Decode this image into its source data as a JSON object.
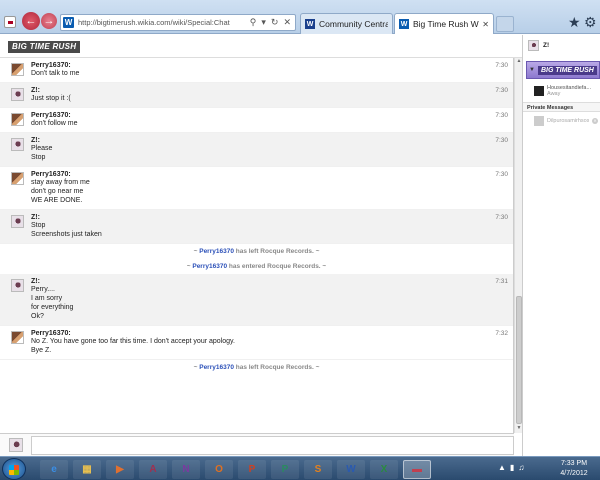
{
  "browser": {
    "address": "http://bigtimerush.wikia.com/wiki/Special:Chat",
    "tabs": [
      {
        "label": "Community Central: W...",
        "icon": "W"
      },
      {
        "label": "Big Time Rush Wiki: ...",
        "icon": "W"
      }
    ],
    "address_icon": "W"
  },
  "wiki": {
    "brand": "BIG TIME RUSH"
  },
  "messages": [
    {
      "user": "Perry16370:",
      "lines": [
        "Don't talk to me"
      ],
      "time": "7:30",
      "alt": false,
      "avatar": "perry"
    },
    {
      "user": "Z!:",
      "lines": [
        "Just stop it :("
      ],
      "time": "7:30",
      "alt": true,
      "avatar": "z"
    },
    {
      "user": "Perry16370:",
      "lines": [
        "don't follow me"
      ],
      "time": "7:30",
      "alt": false,
      "avatar": "perry"
    },
    {
      "user": "Z!:",
      "lines": [
        "Please",
        "Stop"
      ],
      "time": "7:30",
      "alt": true,
      "avatar": "z"
    },
    {
      "user": "Perry16370:",
      "lines": [
        "stay away from me",
        "don't go near me",
        "WE ARE DONE."
      ],
      "time": "7:30",
      "alt": false,
      "avatar": "perry"
    },
    {
      "user": "Z!:",
      "lines": [
        "Stop",
        "Screenshots just taken"
      ],
      "time": "7:30",
      "alt": true,
      "avatar": "z"
    }
  ],
  "notices": [
    {
      "prefix": "~ ",
      "name": "Perry16370",
      "text": " has left Rocque Records. ~"
    },
    {
      "prefix": "~ ",
      "name": "Perry16370",
      "text": " has entered Rocque Records. ~"
    }
  ],
  "messages2": [
    {
      "user": "Z!:",
      "lines": [
        "Perry....",
        "I am sorry",
        "for everything",
        "Ok?"
      ],
      "time": "7:31",
      "alt": true,
      "avatar": "z"
    },
    {
      "user": "Perry16370:",
      "lines": [
        "No Z. You have gone too far this time. I don't accept your apology.",
        "Bye Z."
      ],
      "time": "7:32",
      "alt": false,
      "avatar": "perry"
    }
  ],
  "notice_last": {
    "prefix": "~ ",
    "name": "Perry16370",
    "text": " has left Rocque Records. ~"
  },
  "rail": {
    "me": "Z!",
    "room_logo": "BIG TIME RUSH",
    "users": [
      {
        "name": "Housesitandiefa...",
        "status": "Away"
      }
    ],
    "pm_header": "Private Messages",
    "pm_items": [
      {
        "name": "Dilpurosamirhsos"
      }
    ]
  },
  "taskbar": {
    "apps": [
      {
        "icon": "e",
        "color": "#3a8ee6"
      },
      {
        "icon": "▦",
        "color": "#e8c050"
      },
      {
        "icon": "▶",
        "color": "#e07030"
      },
      {
        "icon": "A",
        "color": "#a03050"
      },
      {
        "icon": "N",
        "color": "#7a3aa0"
      },
      {
        "icon": "O",
        "color": "#e07020"
      },
      {
        "icon": "P",
        "color": "#d04020"
      },
      {
        "icon": "P",
        "color": "#2a8a60"
      },
      {
        "icon": "S",
        "color": "#e08020"
      },
      {
        "icon": "W",
        "color": "#2a5ab0"
      },
      {
        "icon": "X",
        "color": "#2a8a40"
      },
      {
        "icon": "▬",
        "color": "#c04050"
      }
    ],
    "time": "7:33 PM",
    "date": "4/7/2012"
  }
}
